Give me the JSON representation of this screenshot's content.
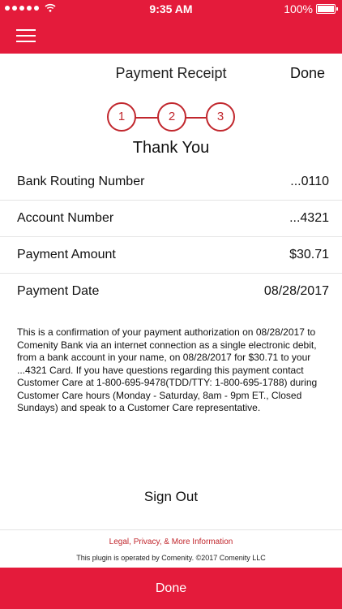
{
  "status_bar": {
    "time": "9:35 AM",
    "battery": "100%",
    "signal_icon": "signal-dots-icon",
    "wifi_icon": "wifi-icon"
  },
  "nav": {
    "menu_icon": "hamburger-icon",
    "accent_color": "#e41b3b"
  },
  "header": {
    "title": "Payment Receipt",
    "done_label": "Done"
  },
  "steps": [
    "1",
    "2",
    "3"
  ],
  "thank_you": "Thank You",
  "details": [
    {
      "label": "Bank Routing Number",
      "value": "...0110"
    },
    {
      "label": "Account Number",
      "value": "...4321"
    },
    {
      "label": "Payment Amount",
      "value": "$30.71"
    },
    {
      "label": "Payment Date",
      "value": "08/28/2017"
    }
  ],
  "confirmation_text": "This is a confirmation of your payment authorization on 08/28/2017 to Comenity Bank via an internet connection as a single electronic debit, from a bank account in your name, on 08/28/2017 for $30.71  to your ...4321  Card.   If you have questions regarding this payment contact Customer Care at 1-800-695-9478(TDD/TTY: 1-800-695-1788) during Customer Care hours (Monday - Saturday, 8am - 9pm ET., Closed Sundays) and speak to a Customer Care representative.",
  "sign_out_label": "Sign Out",
  "legal_link": "Legal, Privacy, & More Information",
  "operated_by": "This plugin is operated by Comenity. ©2017 Comenity LLC",
  "bottom_button": "Done"
}
